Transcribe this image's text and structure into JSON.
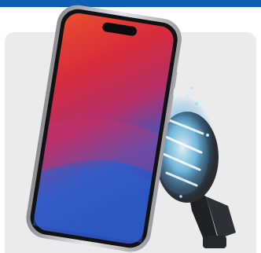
{
  "banner": {
    "color": "#0d5fb4"
  },
  "product": {
    "icons": [
      "phone-icon",
      "magnetic-mount-icon",
      "cooling-fan-icon",
      "air-vent-clip-icon"
    ],
    "colors": {
      "background": "#ebebeb",
      "phone_frame": "#c9c9cc",
      "screen_red": "#e23a2a",
      "screen_blue": "#2c5fc7",
      "cooling_glow": "#6fd4ff",
      "mount_body": "#2a2c30"
    }
  }
}
